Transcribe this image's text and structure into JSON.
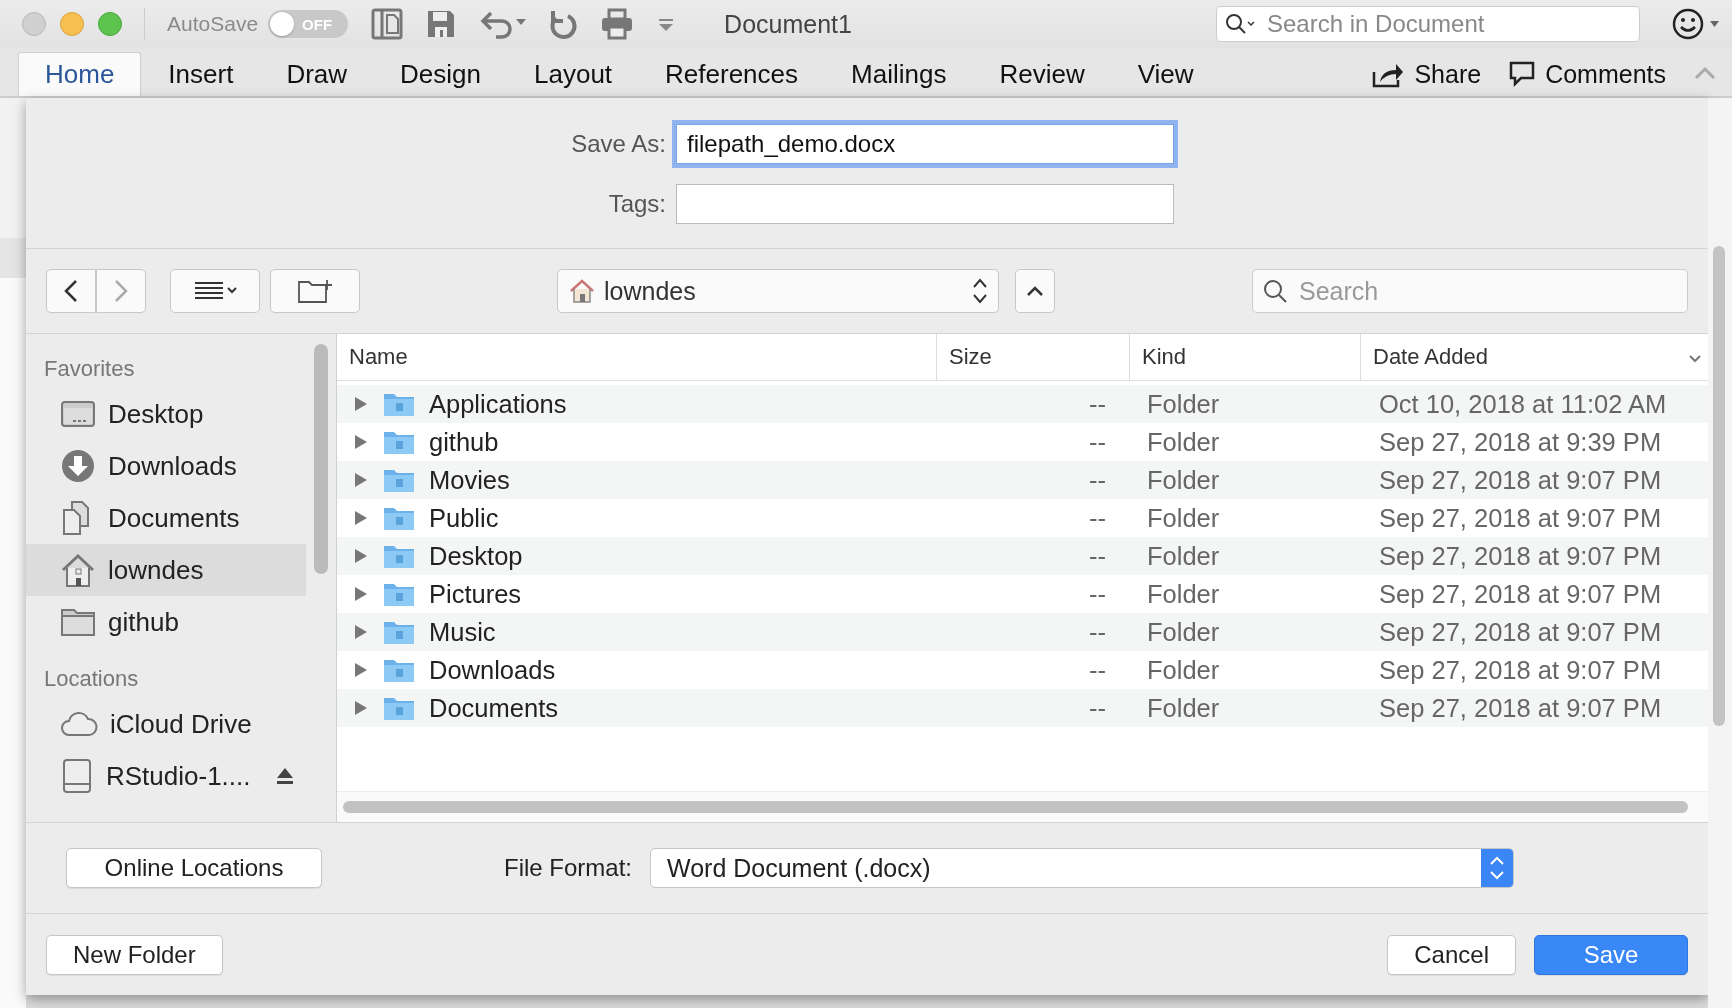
{
  "window": {
    "title": "Document1",
    "autosave_label": "AutoSave",
    "autosave": {
      "label": "OFF",
      "on": false
    },
    "search": {
      "placeholder": "Search in Document"
    }
  },
  "tabs": [
    {
      "label": "Home",
      "selected": true
    },
    {
      "label": "Insert",
      "selected": false
    },
    {
      "label": "Draw",
      "selected": false
    },
    {
      "label": "Design",
      "selected": false
    },
    {
      "label": "Layout",
      "selected": false
    },
    {
      "label": "References",
      "selected": false
    },
    {
      "label": "Mailings",
      "selected": false
    },
    {
      "label": "Review",
      "selected": false
    },
    {
      "label": "View",
      "selected": false
    }
  ],
  "ribbon_actions": [
    {
      "label": "Share",
      "kind": "share"
    },
    {
      "label": "Comments",
      "kind": "comment"
    }
  ],
  "dialog": {
    "save_as": {
      "label": "Save As:",
      "value": "filepath_demo.docx"
    },
    "tags": {
      "label": "Tags:"
    },
    "location": "lowndes",
    "search": {
      "placeholder": "Search"
    },
    "sidebar": [
      {
        "title": "Favorites",
        "items": [
          {
            "label": "Desktop",
            "kind": "desktop",
            "selected": false
          },
          {
            "label": "Downloads",
            "kind": "downloads",
            "selected": false
          },
          {
            "label": "Documents",
            "kind": "documents",
            "selected": false
          },
          {
            "label": "lowndes",
            "kind": "home",
            "selected": true
          },
          {
            "label": "github",
            "kind": "folder",
            "selected": false
          }
        ]
      },
      {
        "title": "Locations",
        "items": [
          {
            "label": "iCloud Drive",
            "kind": "cloud",
            "selected": false
          },
          {
            "label": "RStudio-1....",
            "kind": "drive",
            "selected": false,
            "ejectable": true
          }
        ]
      }
    ],
    "columns": [
      {
        "label": "Name",
        "sorted": false
      },
      {
        "label": "Size",
        "sorted": false
      },
      {
        "label": "Kind",
        "sorted": false
      },
      {
        "label": "Date Added",
        "sorted": true
      }
    ],
    "rows": [
      {
        "name": "Applications",
        "size": "--",
        "kind": "Folder",
        "date": "Oct 10, 2018 at 11:02 AM"
      },
      {
        "name": "github",
        "size": "--",
        "kind": "Folder",
        "date": "Sep 27, 2018 at 9:39 PM"
      },
      {
        "name": "Movies",
        "size": "--",
        "kind": "Folder",
        "date": "Sep 27, 2018 at 9:07 PM"
      },
      {
        "name": "Public",
        "size": "--",
        "kind": "Folder",
        "date": "Sep 27, 2018 at 9:07 PM"
      },
      {
        "name": "Desktop",
        "size": "--",
        "kind": "Folder",
        "date": "Sep 27, 2018 at 9:07 PM"
      },
      {
        "name": "Pictures",
        "size": "--",
        "kind": "Folder",
        "date": "Sep 27, 2018 at 9:07 PM"
      },
      {
        "name": "Music",
        "size": "--",
        "kind": "Folder",
        "date": "Sep 27, 2018 at 9:07 PM"
      },
      {
        "name": "Downloads",
        "size": "--",
        "kind": "Folder",
        "date": "Sep 27, 2018 at 9:07 PM"
      },
      {
        "name": "Documents",
        "size": "--",
        "kind": "Folder",
        "date": "Sep 27, 2018 at 9:07 PM"
      }
    ],
    "online_locations": "Online Locations",
    "file_format": {
      "label": "File Format:",
      "value": "Word Document (.docx)"
    },
    "buttons": {
      "new_folder": "New Folder",
      "cancel": "Cancel",
      "save": "Save"
    }
  }
}
